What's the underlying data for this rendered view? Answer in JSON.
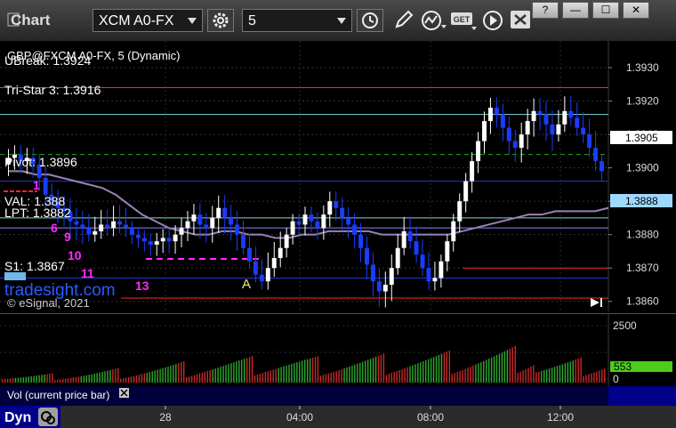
{
  "toolbar": {
    "title": "Chart",
    "symbol": "XCM A0-FX",
    "interval": "5",
    "window_buttons": [
      "?",
      "—",
      "☐",
      "✕"
    ]
  },
  "price_pane": {
    "header": "GBP@FXCM A0-FX, 5 (Dynamic)",
    "level_labels": {
      "ubreak": "UBreak: 1.3924",
      "tristar": "Tri-Star 3: 1.3916",
      "pivot": "Pivot: 1.3896",
      "val": "VAL: 1.388",
      "lpt": "LPT: 1.3882",
      "s1": "S1: 1.3867"
    },
    "watermark": "tradesight.com",
    "copyright": "© eSignal, 2021",
    "marker_a": "A",
    "counters": [
      "1",
      "6",
      "9",
      "10",
      "11",
      "13"
    ],
    "last_price_label": "1.3905",
    "ma_label": "1.3888"
  },
  "volume_pane": {
    "title": "Vol (current price bar)",
    "last_volume": "553",
    "y_ticks": [
      "2500",
      "0"
    ]
  },
  "bottom_bar": {
    "dyn_label": "Dyn"
  },
  "colors": {
    "background": "#000000",
    "up_candle": "#ffffff",
    "down_candle": "#1a3cff",
    "ma_line": "#9a82b4",
    "level_red": "#ff2a2a",
    "level_green": "#1ea81e",
    "level_blue": "#2238c8",
    "level_cyan": "#7fd7d7",
    "pink": "#ff2aff",
    "volume_up": "#2ea82e",
    "volume_down": "#c82828",
    "last_price_box": "#ffffff",
    "ma_box": "#9fd8ff",
    "volume_box": "#4dcc1a"
  },
  "chart_data": [
    {
      "type": "candlestick",
      "symbol": "GBP@FXCM A0-FX",
      "interval": "5",
      "y_axis": {
        "ticks": [
          1.393,
          1.392,
          1.391,
          1.39,
          1.389,
          1.388,
          1.387,
          1.386
        ],
        "tick_labels": [
          "1.3930",
          "1.3920",
          "1.3910",
          "1.3900",
          "1.3890",
          "1.3880",
          "1.3870",
          "1.3860"
        ],
        "range": [
          1.3857,
          1.3938
        ]
      },
      "x_axis": {
        "ticks": [
          "28",
          "04:00",
          "08:00",
          "12:00"
        ]
      },
      "levels": [
        {
          "name": "UBreak",
          "value": 1.3924,
          "color": "#ff2a2a"
        },
        {
          "name": "Tri-Star 3",
          "value": 1.3916,
          "color": "#7fd7d7"
        },
        {
          "name": "green dashed",
          "value": 1.3904,
          "color": "#1ea81e"
        },
        {
          "name": "Pivot",
          "value": 1.3896,
          "color": "#2238c8"
        },
        {
          "name": "VAL",
          "value": 1.3885,
          "color": "#7fd7d7"
        },
        {
          "name": "LPT",
          "value": 1.3882,
          "color": "#8888ff"
        },
        {
          "name": "S1",
          "value": 1.3867,
          "color": "#2238c8"
        },
        {
          "name": "red lower",
          "value": 1.387,
          "color": "#ff2a2a"
        },
        {
          "name": "red bottom",
          "value": 1.3861,
          "color": "#ff2a2a"
        }
      ],
      "closes": [
        1.3903,
        1.3904,
        1.3902,
        1.3903,
        1.3901,
        1.3897,
        1.3892,
        1.389,
        1.3888,
        1.3887,
        1.3884,
        1.3883,
        1.3882,
        1.388,
        1.3881,
        1.3883,
        1.3882,
        1.3884,
        1.3883,
        1.3882,
        1.388,
        1.3879,
        1.3878,
        1.3877,
        1.3878,
        1.3879,
        1.3878,
        1.388,
        1.3882,
        1.3884,
        1.3886,
        1.3883,
        1.3882,
        1.3885,
        1.3888,
        1.3885,
        1.3883,
        1.388,
        1.3876,
        1.3872,
        1.3868,
        1.3866,
        1.387,
        1.3873,
        1.3876,
        1.388,
        1.3884,
        1.3883,
        1.3886,
        1.3884,
        1.3882,
        1.3886,
        1.389,
        1.3888,
        1.3885,
        1.3883,
        1.388,
        1.3876,
        1.3871,
        1.3866,
        1.3863,
        1.3865,
        1.387,
        1.3876,
        1.3881,
        1.3878,
        1.3874,
        1.387,
        1.3866,
        1.3867,
        1.3872,
        1.3878,
        1.3884,
        1.389,
        1.3896,
        1.3902,
        1.3908,
        1.3914,
        1.3918,
        1.3916,
        1.3912,
        1.3908,
        1.3906,
        1.391,
        1.3914,
        1.3917,
        1.3916,
        1.3913,
        1.391,
        1.3913,
        1.3917,
        1.3915,
        1.3912,
        1.391,
        1.3906,
        1.3902,
        1.3899
      ],
      "moving_average": [
        1.3899,
        1.3899,
        1.3898,
        1.3898,
        1.3897,
        1.3896,
        1.3895,
        1.3894,
        1.3892,
        1.3889,
        1.3886,
        1.3884,
        1.3882,
        1.3881,
        1.388,
        1.388,
        1.3881,
        1.3881,
        1.388,
        1.388,
        1.3879,
        1.3879,
        1.388,
        1.388,
        1.3881,
        1.3881,
        1.3881,
        1.3881,
        1.388,
        1.388,
        1.388,
        1.388,
        1.388,
        1.388,
        1.3881,
        1.3882,
        1.3883,
        1.3884,
        1.3885,
        1.3886,
        1.3886,
        1.3887,
        1.3887,
        1.3887,
        1.3887,
        1.3888
      ],
      "last_price": 1.3905,
      "ma_last": 1.3888
    },
    {
      "type": "bar",
      "name": "Vol (current price bar)",
      "y_axis": {
        "ticks": [
          2500,
          0
        ],
        "range": [
          0,
          3100
        ]
      },
      "last_value": 553
    }
  ]
}
